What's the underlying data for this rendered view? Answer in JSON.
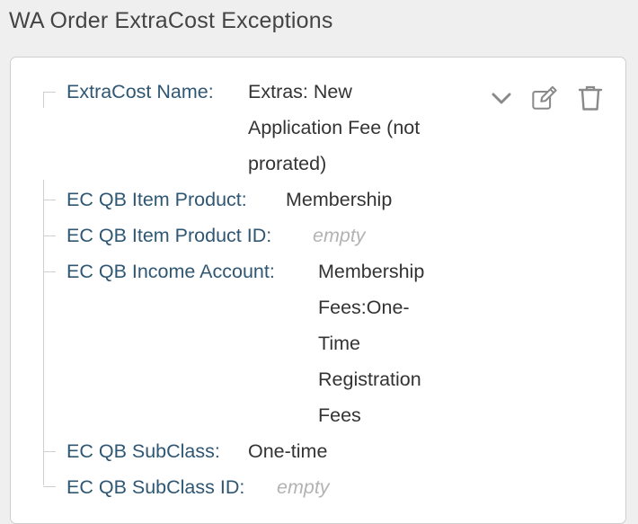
{
  "page": {
    "title": "WA Order ExtraCost Exceptions"
  },
  "record": {
    "fields": [
      {
        "label": "ExtraCost Name:",
        "value_lines": [
          "Extras: New",
          "Application Fee (not",
          "prorated)"
        ]
      },
      {
        "label": "EC QB Item Product:",
        "value": "Membership"
      },
      {
        "label": "EC QB Item Product ID:",
        "value": "empty",
        "empty": true
      },
      {
        "label": "EC QB Income Account:",
        "value_lines": [
          "Membership",
          "Fees:One-",
          "Time",
          "Registration",
          "Fees"
        ]
      },
      {
        "label": "EC QB SubClass:",
        "value": "One-time"
      },
      {
        "label": "EC QB SubClass ID:",
        "value": "empty",
        "empty": true
      }
    ]
  },
  "actions": {
    "icons": [
      "chevron-down-icon",
      "edit-icon",
      "trash-icon"
    ],
    "icon_color": "#8a8a8a"
  },
  "colors": {
    "label": "#2f5773",
    "value": "#333333",
    "empty": "#b3b3b3",
    "background": "#efefef",
    "panel": "#ffffff"
  }
}
